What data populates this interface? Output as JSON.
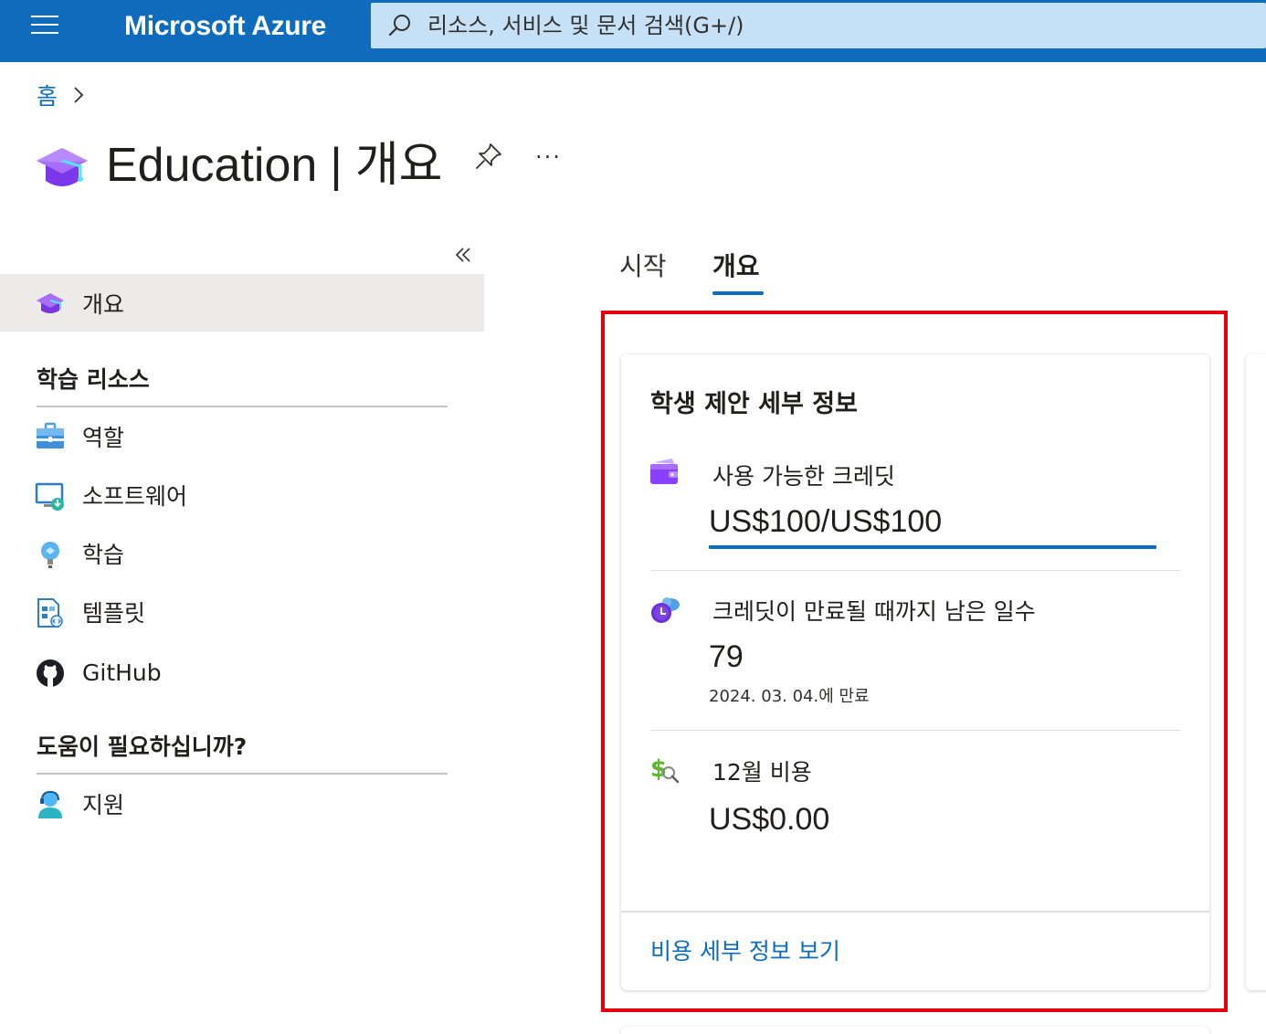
{
  "header": {
    "brand": "Microsoft Azure",
    "search_placeholder": "리소스, 서비스 및 문서 검색(G+/)"
  },
  "breadcrumb": {
    "home": "홈"
  },
  "page": {
    "resource_name": "Education",
    "separator": "|",
    "blade_name": "개요",
    "more": "···"
  },
  "sidebar": {
    "selected_item": {
      "label": "개요",
      "icon": "graduation-cap-icon"
    },
    "sections": [
      {
        "header": "학습 리소스",
        "items": [
          {
            "label": "역할",
            "icon": "briefcase-icon"
          },
          {
            "label": "소프트웨어",
            "icon": "monitor-download-icon"
          },
          {
            "label": "학습",
            "icon": "lightbulb-icon"
          },
          {
            "label": "템플릿",
            "icon": "template-icon"
          },
          {
            "label": "GitHub",
            "icon": "github-icon"
          }
        ]
      },
      {
        "header": "도움이 필요하십니까?",
        "items": [
          {
            "label": "지원",
            "icon": "support-person-icon"
          }
        ]
      }
    ]
  },
  "tabs": [
    {
      "label": "시작",
      "active": false
    },
    {
      "label": "개요",
      "active": true
    }
  ],
  "card": {
    "title": "학생 제안 세부 정보",
    "rows": [
      {
        "label": "사용 가능한 크레딧",
        "value": "US$100/US$100",
        "progress": 1.0,
        "icon": "wallet-icon"
      },
      {
        "label": "크레딧이 만료될 때까지 남은 일수",
        "value": "79",
        "sub": "2024. 03. 04.에 만료",
        "icon": "cloud-clock-icon"
      },
      {
        "label": "12월 비용",
        "value": "US$0.00",
        "icon": "cost-search-icon"
      }
    ],
    "footer_link": "비용 세부 정보 보기"
  },
  "colors": {
    "accent": "#0f6cbd",
    "highlight_border": "#e3000b",
    "selected_bg": "#edebe9"
  }
}
